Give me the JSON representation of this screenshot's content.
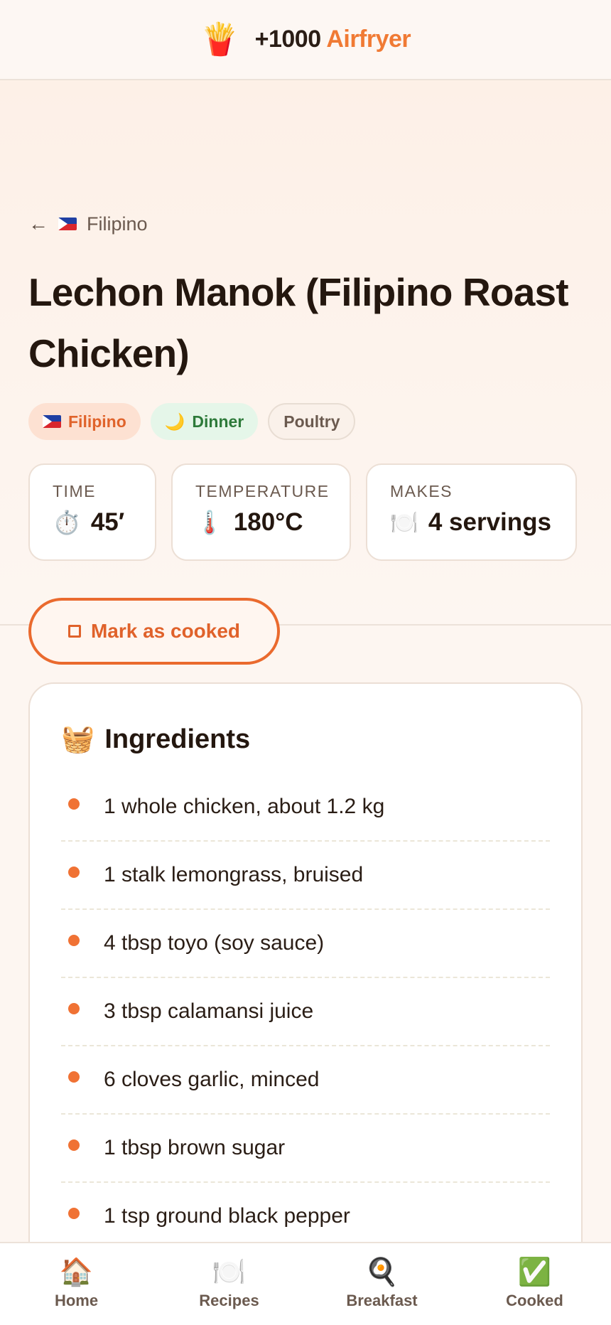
{
  "header": {
    "logo_icon": "🍟",
    "brand_num": "+1000",
    "brand_accent": "Airfryer"
  },
  "breadcrumb": {
    "back_icon": "←",
    "label": "Filipino"
  },
  "recipe": {
    "title": "Lechon Manok (Filipino Roast Chicken)",
    "tags": {
      "cuisine": "Filipino",
      "meal_icon": "🌙",
      "meal": "Dinner",
      "category": "Poultry"
    },
    "stats": {
      "time_label": "TIME",
      "time_icon": "⏱️",
      "time_value": "45′",
      "temp_label": "TEMPERATURE",
      "temp_icon": "🌡️",
      "temp_value": "180°C",
      "makes_label": "MAKES",
      "makes_icon": "🍽️",
      "makes_value": "4 servings"
    },
    "cook_button": "Mark as cooked"
  },
  "ingredients": {
    "icon": "🧺",
    "heading": "Ingredients",
    "items": [
      "1 whole chicken, about 1.2 kg",
      "1 stalk lemongrass, bruised",
      "4 tbsp toyo (soy sauce)",
      "3 tbsp calamansi juice",
      "6 cloves garlic, minced",
      "1 tbsp brown sugar",
      "1 tsp ground black pepper"
    ]
  },
  "nav": {
    "home_icon": "🏠",
    "home": "Home",
    "recipes_icon": "🍽️",
    "recipes": "Recipes",
    "breakfast_icon": "🍳",
    "breakfast": "Breakfast",
    "cooked_icon": "✅",
    "cooked": "Cooked"
  },
  "colors": {
    "accent": "#f07a34",
    "background": "#fdf6f1"
  }
}
